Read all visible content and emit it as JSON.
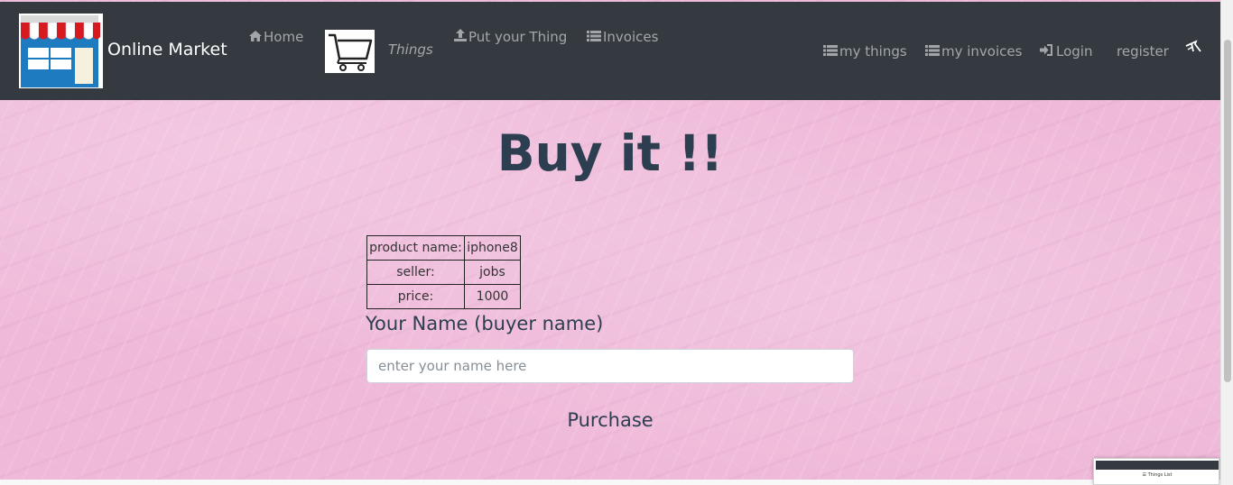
{
  "navbar": {
    "brand": "Online Market",
    "links": {
      "home": "Home",
      "things": "Things",
      "put_thing": "Put your Thing",
      "invoices": "Invoices",
      "my_things": "my things",
      "my_invoices": "my invoices",
      "login": "Login",
      "register": "register"
    }
  },
  "main": {
    "title": "Buy it !!",
    "product": {
      "rows": [
        {
          "label": "product name:",
          "value": "iphone8"
        },
        {
          "label": "seller:",
          "value": "jobs"
        },
        {
          "label": "price:",
          "value": "1000"
        }
      ]
    },
    "buyer_label": "Your Name (buyer name)",
    "buyer_placeholder": "enter your name here",
    "purchase_label": "Purchase"
  },
  "preview": {
    "text": "Things List"
  },
  "colors": {
    "navbar": "#343a40",
    "background": "#efb9d9",
    "heading": "#2c3e50"
  }
}
